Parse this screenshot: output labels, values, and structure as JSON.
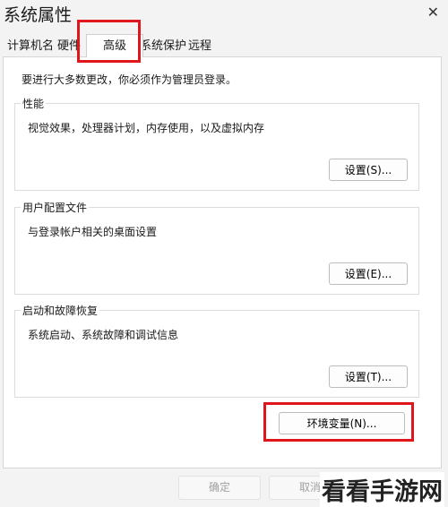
{
  "window": {
    "title": "系统属性"
  },
  "tabs": [
    {
      "label": "计算机名"
    },
    {
      "label": "硬件"
    },
    {
      "label": "高级"
    },
    {
      "label": "系统保护"
    },
    {
      "label": "远程"
    }
  ],
  "notice": "要进行大多数更改，你必须作为管理员登录。",
  "groups": {
    "performance": {
      "title": "性能",
      "desc": "视觉效果，处理器计划，内存使用，以及虚拟内存",
      "button": "设置(S)..."
    },
    "profiles": {
      "title": "用户配置文件",
      "desc": "与登录帐户相关的桌面设置",
      "button": "设置(E)..."
    },
    "startup": {
      "title": "启动和故障恢复",
      "desc": "系统启动、系统故障和调试信息",
      "button": "设置(T)..."
    }
  },
  "env_button": "环境变量(N)...",
  "footer": {
    "ok": "确定",
    "cancel": "取消"
  },
  "watermark": "看看手游网",
  "colors": {
    "highlight": "#e0161d"
  }
}
